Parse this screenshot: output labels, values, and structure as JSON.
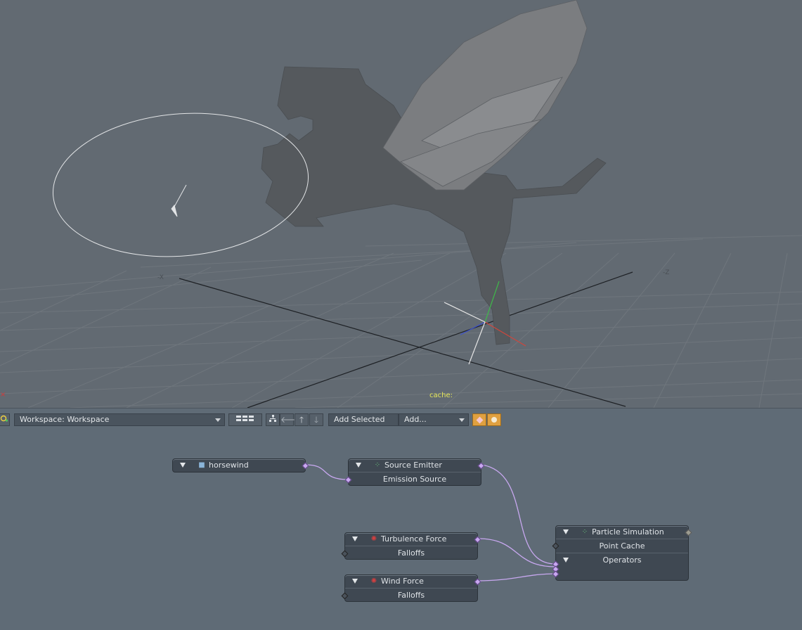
{
  "viewport": {
    "axis_labels": {
      "neg_x": "-X",
      "neg_z": "-Z"
    },
    "cache_label": "cache:"
  },
  "toolbar": {
    "workspace_label": "Workspace: Workspace",
    "add_selected_label": "Add Selected",
    "add_label": "Add...",
    "accent_color": "#e0a040"
  },
  "nodes": {
    "horsewind": {
      "title": "horsewind"
    },
    "source_emitter": {
      "title": "Source Emitter",
      "sub": "Emission Source"
    },
    "turbulence_force": {
      "title": "Turbulence Force",
      "sub": "Falloffs"
    },
    "wind_force": {
      "title": "Wind Force",
      "sub": "Falloffs"
    },
    "particle_simulation": {
      "title": "Particle Simulation",
      "rows": [
        "Point Cache",
        "Operators"
      ]
    }
  },
  "colors": {
    "wire": "#c8a8f0",
    "viewport_bg": "#626a72",
    "panel_bg": "#5f6b76",
    "node_bg": "#3f4852"
  }
}
